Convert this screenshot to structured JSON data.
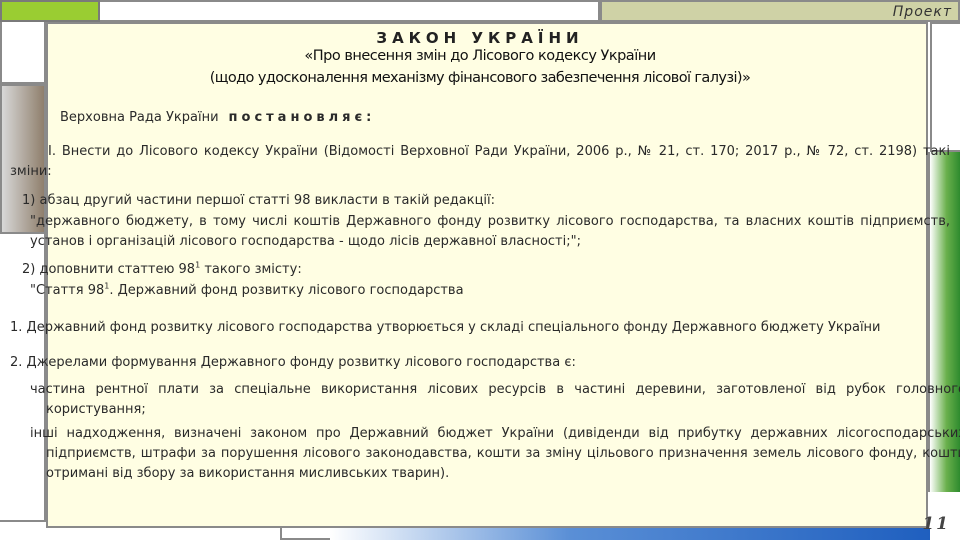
{
  "header": {
    "project_label": "Проект"
  },
  "law": {
    "title": "ЗАКОН УКРАЇНИ",
    "subtitle_1": "«Про внесення змін до Лісового кодексу України",
    "subtitle_2": "(щодо удосконалення механізму фінансового забезпечення лісової галузі)»"
  },
  "preamble": {
    "rada": "Верховна Рада України",
    "decree": "постановляє:"
  },
  "body": {
    "para_i": "І. Внести до Лісового кодексу України (Відомості Верховної Ради України, 2006 р., № 21, ст. 170; 2017 р., № 72, ст. 2198) такі зміни:",
    "item1_head": "1) абзац другий частини першої статті 98 викласти в такій редакції:",
    "item1_quote": "\"державного бюджету, в тому числі коштів Державного фонду розвитку лісового господарства, та власних коштів підприємств, установ і організацій лісового господарства - щодо лісів державної власності;\";",
    "item2_head_a": "2) доповнити статтею 98",
    "item2_head_sup": "1",
    "item2_head_b": " такого змісту:",
    "item2_quote_a": "\"Стаття 98",
    "item2_quote_sup": "1",
    "item2_quote_b": ". Державний фонд розвитку лісового господарства",
    "art_1": "1. Державний фонд розвитку лісового господарства утворюється у складі спеціального фонду Державного бюджету України",
    "art_2": "2. Джерелами формування Державного фонду розвитку лісового господарства є:",
    "src_1": "частина рентної плати за спеціальне використання лісових ресурсів в частині деревини, заготовленої від рубок головного користування;",
    "src_2": "інші надходження, визначені законом про Державний бюджет України (дивіденди від прибутку державних лісогосподарських підприємств, штрафи за порушення лісового законодавства, кошти за зміну цільового призначення земель лісового фонду, кошти отримані від збору за використання мисливських тварин)."
  },
  "footer": {
    "page_number": "11"
  },
  "colors": {
    "panel_bg": "#fffee3",
    "accent_lime": "#9acd32",
    "accent_green": "#2e8b2e",
    "accent_blue": "#1f5fbf"
  }
}
